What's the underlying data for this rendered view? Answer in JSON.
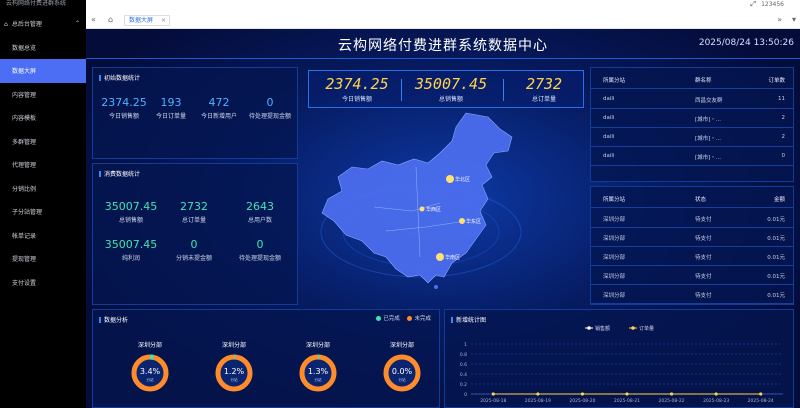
{
  "sidebar": {
    "brand": "云构网络付费进群系统",
    "group_label": "总后台管理",
    "items": [
      {
        "label": "数据总览",
        "active": false
      },
      {
        "label": "数据大屏",
        "active": true
      },
      {
        "label": "内容管理",
        "active": false
      },
      {
        "label": "内容模板",
        "active": false
      },
      {
        "label": "多群管理",
        "active": false
      },
      {
        "label": "代理管理",
        "active": false
      },
      {
        "label": "分销比例",
        "active": false
      },
      {
        "label": "子分站管理",
        "active": false
      },
      {
        "label": "帐单记录",
        "active": false
      },
      {
        "label": "提现管理",
        "active": false
      },
      {
        "label": "支付设置",
        "active": false
      }
    ]
  },
  "topbar": {
    "user": "123456",
    "expand": "⤢"
  },
  "tabs": {
    "active": "数据大屏",
    "close": "×",
    "prev": "«",
    "home": "⌂",
    "next": "»",
    "more": "▾"
  },
  "dashboard": {
    "title": "云构网络付费进群系统数据中心",
    "datetime": "2025/08/24 13:50:26",
    "today": {
      "title": "初始数据统计",
      "stats": [
        {
          "value": "2374.25",
          "label": "今日销售额"
        },
        {
          "value": "193",
          "label": "今日订单量"
        },
        {
          "value": "472",
          "label": "今日新增用户"
        },
        {
          "value": "0",
          "label": "待处理提现金额"
        }
      ]
    },
    "sales": {
      "title": "消费数据统计",
      "stats": [
        {
          "value": "35007.45",
          "label": "总销售额"
        },
        {
          "value": "2732",
          "label": "总订单量"
        },
        {
          "value": "2643",
          "label": "总用户数"
        },
        {
          "value": "35007.45",
          "label": "纯利润"
        },
        {
          "value": "0",
          "label": "分销未提金额"
        },
        {
          "value": "0",
          "label": "待处理提现金额"
        }
      ]
    },
    "center": [
      {
        "value": "2374.25",
        "label": "今日销售额"
      },
      {
        "value": "35007.45",
        "label": "总销售额"
      },
      {
        "value": "2732",
        "label": "总订单量"
      }
    ],
    "map_points": [
      {
        "label": "华北区"
      },
      {
        "label": "华西区"
      },
      {
        "label": "华东区"
      },
      {
        "label": "华南区"
      }
    ],
    "groups_table": {
      "headers": [
        "所属分站",
        "群名称",
        "订单数"
      ],
      "rows": [
        [
          "daili",
          "西昌交友群",
          "11"
        ],
        [
          "daili",
          "[城市]・...",
          "2"
        ],
        [
          "daili",
          "[城市]・...",
          "2"
        ],
        [
          "daili",
          "[城市]・...",
          "0"
        ]
      ]
    },
    "orders_table": {
      "headers": [
        "所属分站",
        "状态",
        "金额"
      ],
      "rows": [
        [
          "深圳分部",
          "待支付",
          "0.01元"
        ],
        [
          "深圳分部",
          "待支付",
          "0.01元"
        ],
        [
          "深圳分部",
          "待支付",
          "0.01元"
        ],
        [
          "深圳分部",
          "待支付",
          "0.01元"
        ],
        [
          "深圳分部",
          "待支付",
          "0.01元"
        ]
      ]
    },
    "branch": {
      "title": "数据分析",
      "legend": [
        "已完成",
        "未完成"
      ],
      "items": [
        {
          "name": "深圳分部",
          "pct": "3.4%",
          "sub": "分站"
        },
        {
          "name": "深圳分部",
          "pct": "1.2%",
          "sub": "分站"
        },
        {
          "name": "深圳分部",
          "pct": "1.3%",
          "sub": "分站"
        },
        {
          "name": "深圳分部",
          "pct": "0.0%",
          "sub": "分站"
        }
      ],
      "values": [
        3.4,
        1.2,
        1.3,
        0.0
      ],
      "colors": {
        "done": "#3fe6b0",
        "todo": "#ff8c2a"
      }
    },
    "trend": {
      "title": "新增统计图",
      "legend": [
        "销售额",
        "订单量"
      ]
    }
  },
  "chart_data": {
    "type": "line",
    "title": "新增统计图",
    "x": [
      "2025-08-18",
      "2025-08-19",
      "2025-08-20",
      "2025-08-21",
      "2025-08-22",
      "2025-08-23",
      "2025-08-24"
    ],
    "series": [
      {
        "name": "销售额",
        "values": [
          0,
          0,
          0,
          0,
          0,
          0,
          0
        ]
      },
      {
        "name": "订单量",
        "values": [
          0,
          0,
          0,
          0,
          0,
          0,
          0
        ]
      }
    ],
    "yticks": [
      "0",
      "0.2",
      "0.4",
      "0.6",
      "0.8",
      "1"
    ],
    "ylim": [
      0,
      1
    ],
    "grid": true,
    "legend": "top-center"
  }
}
